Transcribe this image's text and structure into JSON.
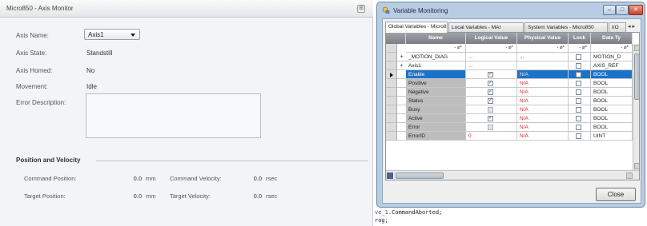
{
  "axis_monitor": {
    "title": "Micro850 - Axis Monitor",
    "pin_icon": "pin-icon",
    "fields": {
      "axis_name_label": "Axis Name:",
      "axis_name_value": "Axis1",
      "axis_state_label": "Axis State:",
      "axis_state_value": "Standstill",
      "axis_homed_label": "Axis Homed:",
      "axis_homed_value": "No",
      "movement_label": "Movement:",
      "movement_value": "Idle",
      "error_description_label": "Error Description:",
      "error_description_value": ""
    },
    "position_velocity": {
      "header": "Position and Velocity",
      "command_position_label": "Command Position:",
      "command_position_value": "0.0",
      "command_position_unit": "mm",
      "command_velocity_label": "Command Velocity:",
      "command_velocity_value": "0.0",
      "command_velocity_unit": "rsec",
      "target_position_label": "Target Position:",
      "target_position_value": "0.0",
      "target_position_unit": "mm",
      "target_velocity_label": "Target Velocity:",
      "target_velocity_value": "0.0",
      "target_velocity_unit": "rsec"
    }
  },
  "variable_monitoring": {
    "title": "Variable Monitoring",
    "window_buttons": {
      "minimize": "‒",
      "maximize": "□",
      "close": "✕"
    },
    "tabs": [
      {
        "label": "Global Variables - Micro850",
        "active": true
      },
      {
        "label": "Local Variables - MAI",
        "active": false
      },
      {
        "label": "System Variables - Micro850",
        "active": false
      },
      {
        "label": "I/O",
        "active": false
      }
    ],
    "tab_nav": "◂ ▸",
    "columns": [
      "Name",
      "Logical Value",
      "Physical Value",
      "Lock",
      "Data Ty"
    ],
    "filter_glyph": "- ⌀*",
    "rows": [
      {
        "expander": "+",
        "name": "_MOTION_DIAG",
        "logical": "...",
        "logical_red": true,
        "physical": "...",
        "physical_red": false,
        "lock": false,
        "type": "MOTION_D",
        "selected": false,
        "check": "none"
      },
      {
        "expander": "+",
        "name": "Axis1",
        "logical": "...",
        "logical_red": true,
        "physical": "",
        "physical_red": false,
        "lock": false,
        "type": "AXIS_REF",
        "selected": false,
        "check": "none"
      },
      {
        "expander": "",
        "name": "Enable",
        "logical": "",
        "logical_red": false,
        "physical": "N/A",
        "physical_red": true,
        "lock": false,
        "type": "BOOL",
        "selected": true,
        "check": "checked"
      },
      {
        "expander": "",
        "name": "Positive",
        "logical": "",
        "logical_red": false,
        "physical": "N/A",
        "physical_red": true,
        "lock": false,
        "type": "BOOL",
        "selected": false,
        "check": "checked"
      },
      {
        "expander": "",
        "name": "Negative",
        "logical": "",
        "logical_red": false,
        "physical": "N/A",
        "physical_red": true,
        "lock": false,
        "type": "BOOL",
        "selected": false,
        "check": "checked"
      },
      {
        "expander": "",
        "name": "Status",
        "logical": "",
        "logical_red": false,
        "physical": "N/A",
        "physical_red": true,
        "lock": false,
        "type": "BOOL",
        "selected": false,
        "check": "checked"
      },
      {
        "expander": "",
        "name": "Busy",
        "logical": "",
        "logical_red": false,
        "physical": "N/A",
        "physical_red": true,
        "lock": false,
        "type": "BOOL",
        "selected": false,
        "check": "dim"
      },
      {
        "expander": "",
        "name": "Active",
        "logical": "",
        "logical_red": false,
        "physical": "N/A",
        "physical_red": true,
        "lock": false,
        "type": "BOOL",
        "selected": false,
        "check": "checked"
      },
      {
        "expander": "",
        "name": "Error",
        "logical": "",
        "logical_red": false,
        "physical": "N/A",
        "physical_red": true,
        "lock": false,
        "type": "BOOL",
        "selected": false,
        "check": "dim"
      },
      {
        "expander": "",
        "name": "ErrorID",
        "logical": "0",
        "logical_red": true,
        "physical": "N/A",
        "physical_red": true,
        "lock": false,
        "type": "UINT",
        "selected": false,
        "check": "none"
      }
    ],
    "close_button": "Close"
  },
  "code_editor": {
    "line1_prefix": "ve_1",
    "line1_rest": ".CommandAborted;",
    "line2": "rog;"
  },
  "colors": {
    "row_selected": "#1a73c8",
    "row_gray": "#bdbdbd",
    "value_red": "#e02020",
    "check_blue": "#1f3f9a"
  }
}
